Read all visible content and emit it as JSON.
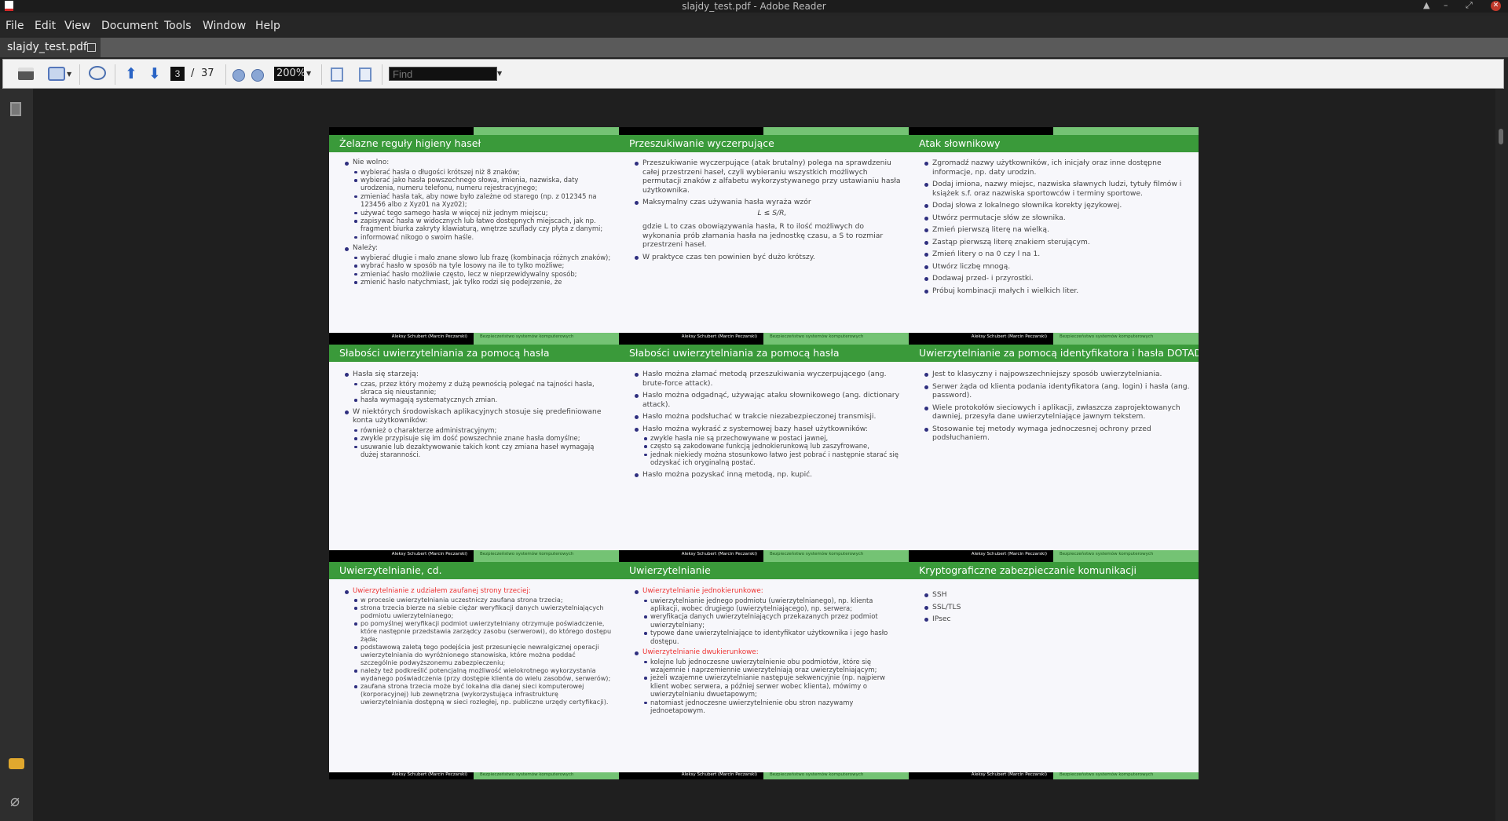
{
  "window": {
    "title": "slajdy_test.pdf - Adobe Reader",
    "controls": [
      "▲",
      "–",
      "⤢",
      "✕"
    ]
  },
  "menu": [
    "File",
    "Edit",
    "View",
    "Document",
    "Tools",
    "Window",
    "Help"
  ],
  "tab": {
    "label": "slajdy_test.pdf"
  },
  "toolbar": {
    "page_current": "3",
    "page_sep": "/",
    "page_total": "37",
    "zoom": "200%",
    "find_placeholder": "Find"
  },
  "icons": {
    "left_panel": [
      "pages-icon",
      "comments-icon",
      "attachment-icon"
    ],
    "colors": {
      "header_green": "#3a9a3a",
      "light_green": "#74c374",
      "red_text": "#ee3333"
    }
  },
  "footer": {
    "author": "Aleksy Schubert (Marcin Peczarski)",
    "course": "Bezpieczeństwo systemów komputerowych"
  },
  "slides": [
    {
      "title": "Żelazne reguły higieny haseł",
      "items": [
        {
          "text": "Nie wolno:",
          "sub": [
            "wybierać hasła o długości krótszej niż 8 znaków;",
            "wybierać jako hasła powszechnego słowa, imienia, nazwiska, daty urodzenia, numeru telefonu, numeru rejestracyjnego;",
            "zmieniać hasła tak, aby nowe było zależne od starego (np. z 012345 na 123456 albo z Xyz01 na Xyz02);",
            "używać tego samego hasła w więcej niż jednym miejscu;",
            "zapisywać hasła w widocznych lub łatwo dostępnych miejscach, jak np. fragment biurka zakryty klawiaturą, wnętrze szuflady czy płyta z danymi;",
            "informować nikogo o swoim haśle."
          ]
        },
        {
          "text": "Należy:",
          "sub": [
            "wybierać długie i mało znane słowo lub frazę (kombinacja różnych znaków);",
            "wybrać hasło w sposób na tyle losowy na ile to tylko możliwe;",
            "zmieniać hasło możliwie często, lecz w nieprzewidywalny sposób;",
            "zmienić hasło natychmiast, jak tylko rodzi się podejrzenie, że"
          ]
        }
      ]
    },
    {
      "title": "Przeszukiwanie wyczerpujące",
      "items": [
        {
          "text": "Przeszukiwanie wyczerpujące (atak brutalny) polega na sprawdzeniu całej przestrzeni haseł, czyli wybieraniu wszystkich możliwych permutacji znaków z alfabetu wykorzystywanego przy ustawianiu hasła użytkownika."
        },
        {
          "text": "Maksymalny czas używania hasła wyraża wzór",
          "formula": "L ≤ S/R,",
          "after": "gdzie L to czas obowiązywania hasła, R to ilość możliwych do wykonania prób złamania hasła na jednostkę czasu, a S to rozmiar przestrzeni haseł."
        },
        {
          "text": "W praktyce czas ten powinien być dużo krótszy."
        }
      ]
    },
    {
      "title": "Atak słownikowy",
      "items": [
        {
          "text": "Zgromadź nazwy użytkowników, ich inicjały oraz inne dostępne informacje, np. daty urodzin."
        },
        {
          "text": "Dodaj imiona, nazwy miejsc, nazwiska sławnych ludzi, tytuły filmów i książek s.f. oraz nazwiska sportowców i terminy sportowe."
        },
        {
          "text": "Dodaj słowa z lokalnego słownika korekty językowej."
        },
        {
          "text": "Utwórz permutacje słów ze słownika."
        },
        {
          "text": "Zmień pierwszą literę na wielką."
        },
        {
          "text": "Zastąp pierwszą literę znakiem sterującym."
        },
        {
          "text": "Zmień litery o na 0 czy l na 1."
        },
        {
          "text": "Utwórz liczbę mnogą."
        },
        {
          "text": "Dodawaj przed- i przyrostki."
        },
        {
          "text": "Próbuj kombinacji małych i wielkich liter."
        }
      ]
    },
    {
      "title": "Słabości uwierzytelniania za pomocą hasła",
      "items": [
        {
          "text": "Hasła się starzeją:",
          "sub": [
            "czas, przez który możemy z dużą pewnością polegać na tajności hasła, skraca się nieustannie;",
            "hasła wymagają systematycznych zmian."
          ]
        },
        {
          "text": "W niektórych środowiskach aplikacyjnych stosuje się predefiniowane konta użytkowników:",
          "sub": [
            "również o charakterze administracyjnym;",
            "zwykle przypisuje się im dość powszechnie znane hasła domyślne;",
            "usuwanie lub dezaktywowanie takich kont czy zmiana haseł wymagają dużej staranności."
          ]
        }
      ]
    },
    {
      "title": "Słabości uwierzytelniania za pomocą hasła",
      "items": [
        {
          "text": "Hasło można złamać metodą przeszukiwania wyczerpującego (ang. brute-force attack)."
        },
        {
          "text": "Hasło można odgadnąć, używając ataku słownikowego (ang. dictionary attack)."
        },
        {
          "text": "Hasło można podsłuchać w trakcie niezabezpieczonej transmisji."
        },
        {
          "text": "Hasło można wykraść z systemowej bazy haseł użytkowników:",
          "sub": [
            "zwykle hasła nie są przechowywane w postaci jawnej,",
            "często są zakodowane funkcją jednokierunkową lub zaszyfrowane,",
            "jednak niekiedy można stosunkowo łatwo jest pobrać i następnie starać się odzyskać ich oryginalną postać."
          ]
        },
        {
          "text": "Hasło można pozyskać inną metodą, np. kupić."
        }
      ]
    },
    {
      "title": "Uwierzytelnianie za pomocą identyfikatora i hasła DOTAD",
      "items": [
        {
          "text": "Jest to klasyczny i najpowszechniejszy sposób uwierzytelniania."
        },
        {
          "text": "Serwer żąda od klienta podania identyfikatora (ang. login) i hasła (ang. password)."
        },
        {
          "text": "Wiele protokołów sieciowych i aplikacji, zwłaszcza zaprojektowanych dawniej, przesyła dane uwierzytelniające jawnym tekstem."
        },
        {
          "text": "Stosowanie tej metody wymaga jednoczesnej ochrony przed podsłuchaniem."
        }
      ]
    },
    {
      "title": "Uwierzytelnianie, cd.",
      "items": [
        {
          "text": "Uwierzytelnianie z udziałem zaufanej strony trzeciej:",
          "red": true,
          "sub": [
            "w procesie uwierzytelniania uczestniczy zaufana strona trzecia;",
            "strona trzecia bierze na siebie ciężar weryfikacji danych uwierzytelniających podmiotu uwierzytelnianego;",
            "po pomyślnej weryfikacji podmiot uwierzytelniany otrzymuje poświadczenie, które następnie przedstawia zarządcy zasobu (serwerowi), do którego dostępu żąda;",
            "podstawową zaletą tego podejścia jest przesunięcie newralgicznej operacji uwierzytelniania do wyróżnionego stanowiska, które można poddać szczególnie podwyższonemu zabezpieczeniu;",
            "należy też podkreślić potencjalną możliwość wielokrotnego wykorzystania wydanego poświadczenia (przy dostępie klienta do wielu zasobów, serwerów);",
            "zaufana strona trzecia może być lokalna dla danej sieci komputerowej (korporacyjnej) lub zewnętrzna (wykorzystująca infrastrukturę uwierzytelniania dostępną w sieci rozległej, np. publiczne urzędy certyfikacji)."
          ]
        }
      ]
    },
    {
      "title": "Uwierzytelnianie",
      "items": [
        {
          "text": "Uwierzytelnianie jednokierunkowe:",
          "red": true,
          "sub": [
            "uwierzytelnianie jednego podmiotu (uwierzytelnianego), np. klienta aplikacji, wobec drugiego (uwierzytelniającego), np. serwera;",
            "weryfikacja danych uwierzytelniających przekazanych przez podmiot uwierzytelniany;",
            "typowe dane uwierzytelniające to identyfikator użytkownika i jego hasło dostępu."
          ]
        },
        {
          "text": "Uwierzytelnianie dwukierunkowe:",
          "red": true,
          "sub": [
            "kolejne lub jednoczesne uwierzytelnienie obu podmiotów, które się wzajemnie i naprzemiennie uwierzytelniają oraz uwierzytelniającym;",
            "jeżeli wzajemne uwierzytelnianie następuje sekwencyjnie (np. najpierw klient wobec serwera, a później serwer wobec klienta), mówimy o uwierzytelnianiu dwuetapowym;",
            "natomiast jednoczesne uwierzytelnienie obu stron nazywamy jednoetapowym."
          ]
        }
      ]
    },
    {
      "title": "Kryptograficzne zabezpieczanie komunikacji",
      "items": [
        {
          "text": "SSH"
        },
        {
          "text": "SSL/TLS"
        },
        {
          "text": "IPsec"
        }
      ]
    }
  ]
}
